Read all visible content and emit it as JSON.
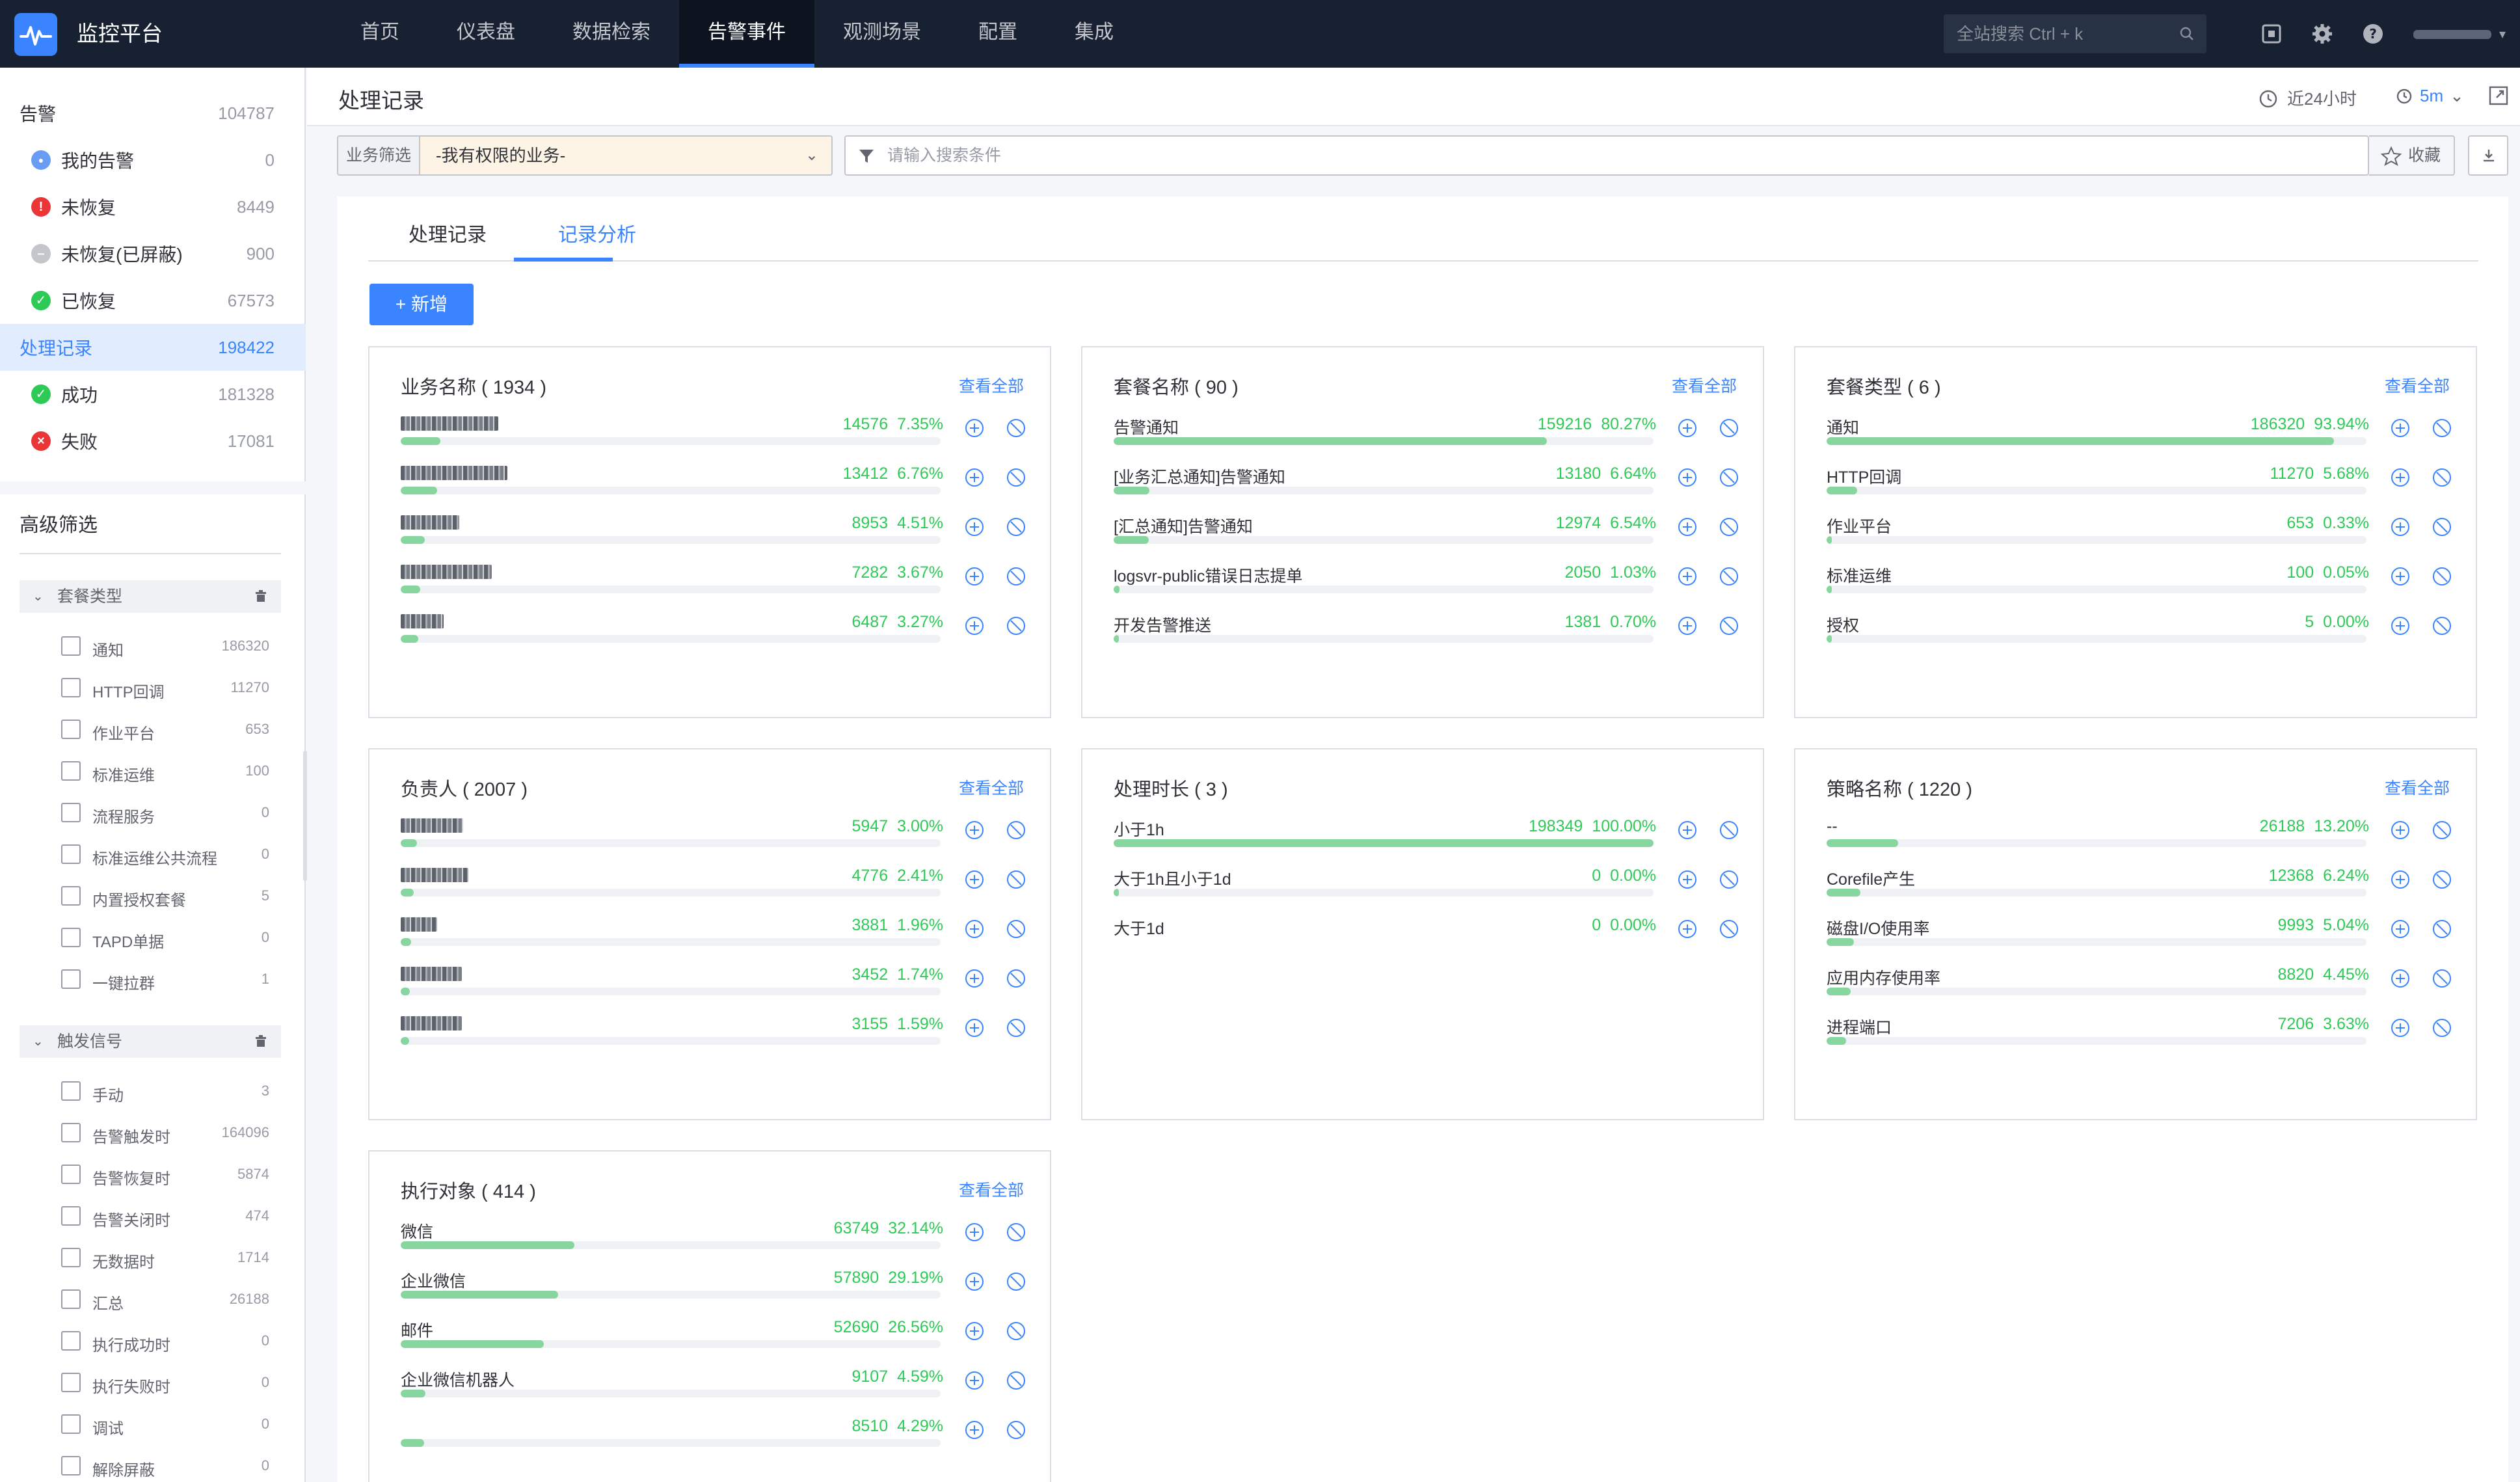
{
  "app": {
    "title": "监控平台"
  },
  "nav": {
    "items": [
      {
        "label": "首页"
      },
      {
        "label": "仪表盘"
      },
      {
        "label": "数据检索"
      },
      {
        "label": "告警事件",
        "active": true
      },
      {
        "label": "观测场景"
      },
      {
        "label": "配置"
      },
      {
        "label": "集成"
      }
    ],
    "search_placeholder": "全站搜索 Ctrl + k"
  },
  "sidebar": {
    "alarm": {
      "label": "告警",
      "count": "104787"
    },
    "alarm_items": [
      {
        "label": "我的告警",
        "count": "0",
        "icon": "user-icon",
        "color": "#699df4"
      },
      {
        "label": "未恢复",
        "count": "8449",
        "icon": "exclamation-icon",
        "color": "#ea3636"
      },
      {
        "label": "未恢复(已屏蔽)",
        "count": "900",
        "icon": "minus-icon",
        "color": "#c4c6cc"
      },
      {
        "label": "已恢复",
        "count": "67573",
        "icon": "check-icon",
        "color": "#2dcb56"
      }
    ],
    "records": {
      "label": "处理记录",
      "count": "198422"
    },
    "record_items": [
      {
        "label": "成功",
        "count": "181328",
        "icon": "check-icon",
        "color": "#2dcb56"
      },
      {
        "label": "失败",
        "count": "17081",
        "icon": "x-icon",
        "color": "#ea3636"
      }
    ],
    "advanced_title": "高级筛选",
    "groups": [
      {
        "label": "套餐类型",
        "options": [
          {
            "label": "通知",
            "count": "186320"
          },
          {
            "label": "HTTP回调",
            "count": "11270"
          },
          {
            "label": "作业平台",
            "count": "653"
          },
          {
            "label": "标准运维",
            "count": "100"
          },
          {
            "label": "流程服务",
            "count": "0"
          },
          {
            "label": "标准运维公共流程",
            "count": "0"
          },
          {
            "label": "内置授权套餐",
            "count": "5"
          },
          {
            "label": "TAPD单据",
            "count": "0"
          },
          {
            "label": "一键拉群",
            "count": "1"
          }
        ]
      },
      {
        "label": "触发信号",
        "options": [
          {
            "label": "手动",
            "count": "3"
          },
          {
            "label": "告警触发时",
            "count": "164096"
          },
          {
            "label": "告警恢复时",
            "count": "5874"
          },
          {
            "label": "告警关闭时",
            "count": "474"
          },
          {
            "label": "无数据时",
            "count": "1714"
          },
          {
            "label": "汇总",
            "count": "26188"
          },
          {
            "label": "执行成功时",
            "count": "0"
          },
          {
            "label": "执行失败时",
            "count": "0"
          },
          {
            "label": "调试",
            "count": "0"
          },
          {
            "label": "解除屏蔽",
            "count": "0"
          }
        ]
      }
    ]
  },
  "header": {
    "title": "处理记录",
    "time_range": "近24小时",
    "refresh": "5m"
  },
  "filter": {
    "label": "业务筛选",
    "value": "-我有权限的业务-",
    "search_placeholder": "请输入搜索条件",
    "favorite": "收藏"
  },
  "tabs": [
    {
      "label": "处理记录"
    },
    {
      "label": "记录分析",
      "active": true
    }
  ],
  "add_button": "+ 新增",
  "view_all": "查看全部",
  "cards": [
    {
      "title": "业务名称 ( 1934 )",
      "show_link": true,
      "items": [
        {
          "name": "",
          "masked": true,
          "mask_width": 150,
          "value": "14576",
          "percent": "7.35%",
          "fill": 0.0735
        },
        {
          "name": "",
          "masked": true,
          "mask_width": 164,
          "value": "13412",
          "percent": "6.76%",
          "fill": 0.0676
        },
        {
          "name": "",
          "masked": true,
          "mask_width": 90,
          "value": "8953",
          "percent": "4.51%",
          "fill": 0.0451
        },
        {
          "name": "",
          "masked": true,
          "mask_width": 140,
          "value": "7282",
          "percent": "3.67%",
          "fill": 0.0367
        },
        {
          "name": "",
          "masked": true,
          "mask_width": 66,
          "value": "6487",
          "percent": "3.27%",
          "fill": 0.0327
        }
      ]
    },
    {
      "title": "套餐名称 ( 90 )",
      "show_link": true,
      "items": [
        {
          "name": "告警通知",
          "value": "159216",
          "percent": "80.27%",
          "fill": 0.8027
        },
        {
          "name": "[业务汇总通知]告警通知",
          "value": "13180",
          "percent": "6.64%",
          "fill": 0.0664
        },
        {
          "name": "[汇总通知]告警通知",
          "value": "12974",
          "percent": "6.54%",
          "fill": 0.0654
        },
        {
          "name": "logsvr-public错误日志提单",
          "value": "2050",
          "percent": "1.03%",
          "fill": 0.0103
        },
        {
          "name": "开发告警推送",
          "value": "1381",
          "percent": "0.70%",
          "fill": 0.007
        }
      ]
    },
    {
      "title": "套餐类型 ( 6 )",
      "show_link": true,
      "items": [
        {
          "name": "通知",
          "value": "186320",
          "percent": "93.94%",
          "fill": 0.9394
        },
        {
          "name": "HTTP回调",
          "value": "11270",
          "percent": "5.68%",
          "fill": 0.0568
        },
        {
          "name": "作业平台",
          "value": "653",
          "percent": "0.33%",
          "fill": 0.0033
        },
        {
          "name": "标准运维",
          "value": "100",
          "percent": "0.05%",
          "fill": 0.0005
        },
        {
          "name": "授权",
          "value": "5",
          "percent": "0.00%",
          "fill": 0.0
        }
      ]
    },
    {
      "title": "负责人 ( 2007 )",
      "show_link": true,
      "items": [
        {
          "name": "",
          "masked": true,
          "mask_width": 96,
          "value": "5947",
          "percent": "3.00%",
          "fill": 0.03
        },
        {
          "name": "",
          "masked": true,
          "mask_width": 104,
          "value": "4776",
          "percent": "2.41%",
          "fill": 0.0241
        },
        {
          "name": "",
          "masked": true,
          "mask_width": 56,
          "value": "3881",
          "percent": "1.96%",
          "fill": 0.0196
        },
        {
          "name": "",
          "masked": true,
          "mask_width": 94,
          "value": "3452",
          "percent": "1.74%",
          "fill": 0.0174
        },
        {
          "name": "",
          "masked": true,
          "mask_width": 94,
          "value": "3155",
          "percent": "1.59%",
          "fill": 0.0159
        }
      ]
    },
    {
      "title": "处理时长 ( 3 )",
      "show_link": false,
      "items": [
        {
          "name": "小于1h",
          "value": "198349",
          "percent": "100.00%",
          "fill": 1.0
        },
        {
          "name": "大于1h且小于1d",
          "value": "0",
          "percent": "0.00%",
          "fill": 0.0
        },
        {
          "name": "大于1d",
          "value": "0",
          "percent": "0.00%",
          "fill": 0.0,
          "no_bar": true
        }
      ]
    },
    {
      "title": "策略名称 ( 1220 )",
      "show_link": true,
      "items": [
        {
          "name": "--",
          "value": "26188",
          "percent": "13.20%",
          "fill": 0.132
        },
        {
          "name": "Corefile产生",
          "value": "12368",
          "percent": "6.24%",
          "fill": 0.0624
        },
        {
          "name": "磁盘I/O使用率",
          "value": "9993",
          "percent": "5.04%",
          "fill": 0.0504
        },
        {
          "name": "应用内存使用率",
          "value": "8820",
          "percent": "4.45%",
          "fill": 0.0445
        },
        {
          "name": "进程端口",
          "value": "7206",
          "percent": "3.63%",
          "fill": 0.0363
        }
      ]
    },
    {
      "title": "执行对象 ( 414 )",
      "show_link": true,
      "items": [
        {
          "name": "微信",
          "value": "63749",
          "percent": "32.14%",
          "fill": 0.3214
        },
        {
          "name": "企业微信",
          "value": "57890",
          "percent": "29.19%",
          "fill": 0.2919
        },
        {
          "name": "邮件",
          "value": "52690",
          "percent": "26.56%",
          "fill": 0.2656
        },
        {
          "name": "企业微信机器人",
          "value": "9107",
          "percent": "4.59%",
          "fill": 0.0459
        },
        {
          "name": "",
          "value": "8510",
          "percent": "4.29%",
          "fill": 0.0429
        }
      ]
    }
  ]
}
